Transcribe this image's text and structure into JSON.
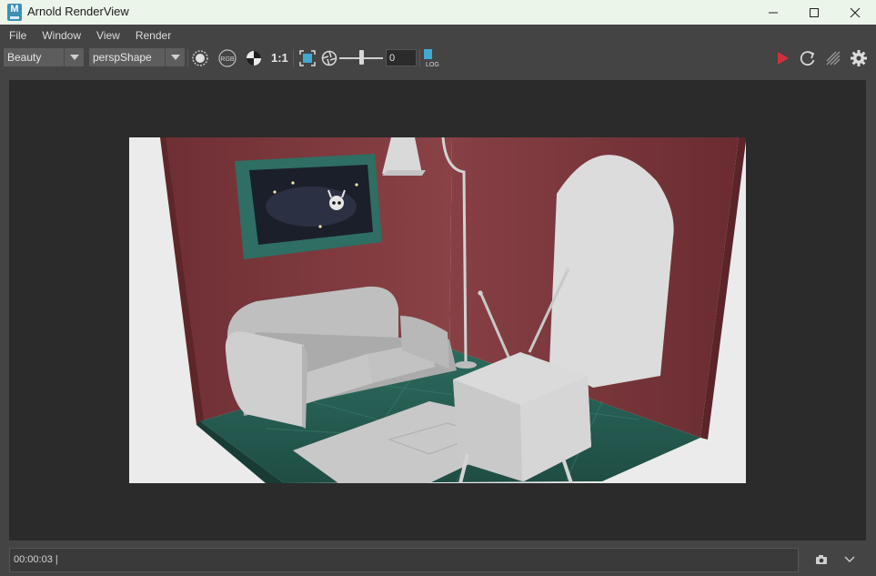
{
  "window": {
    "app_icon_letter": "M",
    "title": "Arnold RenderView",
    "minimize_label": "—",
    "maximize_label": "☐",
    "close_label": "✕"
  },
  "menu": [
    "File",
    "Window",
    "View",
    "Render"
  ],
  "toolbar": {
    "aov_selected": "Beauty",
    "camera_selected": "perspShape",
    "rgb_label": "RGB",
    "ratio_label": "1:1",
    "exposure_value": "0",
    "exposure_level": 0.5,
    "log_label": "LOG"
  },
  "colors": {
    "render_button": "#d0303a",
    "accent": "#3d8fb3"
  },
  "status": {
    "time": "00:00:03 |"
  }
}
